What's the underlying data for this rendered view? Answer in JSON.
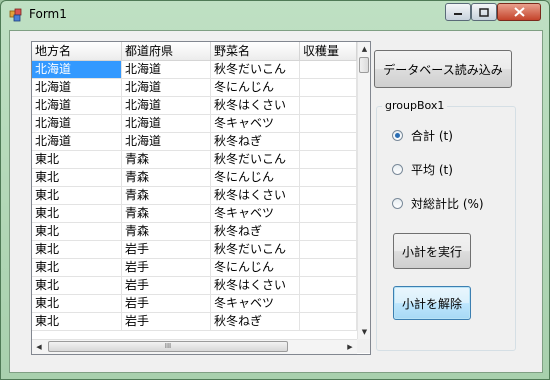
{
  "window": {
    "title": "Form1"
  },
  "grid": {
    "columns": [
      "地方名",
      "都道府県",
      "野菜名",
      "収穫量"
    ],
    "rows": [
      [
        "北海道",
        "北海道",
        "秋冬だいこん",
        ""
      ],
      [
        "北海道",
        "北海道",
        "冬にんじん",
        ""
      ],
      [
        "北海道",
        "北海道",
        "秋冬はくさい",
        ""
      ],
      [
        "北海道",
        "北海道",
        "冬キャベツ",
        ""
      ],
      [
        "北海道",
        "北海道",
        "秋冬ねぎ",
        ""
      ],
      [
        "東北",
        "青森",
        "秋冬だいこん",
        ""
      ],
      [
        "東北",
        "青森",
        "冬にんじん",
        ""
      ],
      [
        "東北",
        "青森",
        "秋冬はくさい",
        ""
      ],
      [
        "東北",
        "青森",
        "冬キャベツ",
        ""
      ],
      [
        "東北",
        "青森",
        "秋冬ねぎ",
        ""
      ],
      [
        "東北",
        "岩手",
        "秋冬だいこん",
        ""
      ],
      [
        "東北",
        "岩手",
        "冬にんじん",
        ""
      ],
      [
        "東北",
        "岩手",
        "秋冬はくさい",
        ""
      ],
      [
        "東北",
        "岩手",
        "冬キャベツ",
        ""
      ],
      [
        "東北",
        "岩手",
        "秋冬ねぎ",
        ""
      ]
    ],
    "scroll_thumb_glyph": "III"
  },
  "buttons": {
    "load": "データベース読み込み",
    "run": "小計を実行",
    "clear": "小計を解除"
  },
  "group": {
    "title": "groupBox1",
    "options": [
      {
        "label": "合計 (t)",
        "checked": true
      },
      {
        "label": "平均 (t)",
        "checked": false
      },
      {
        "label": "対総計比 (%)",
        "checked": false
      }
    ]
  }
}
